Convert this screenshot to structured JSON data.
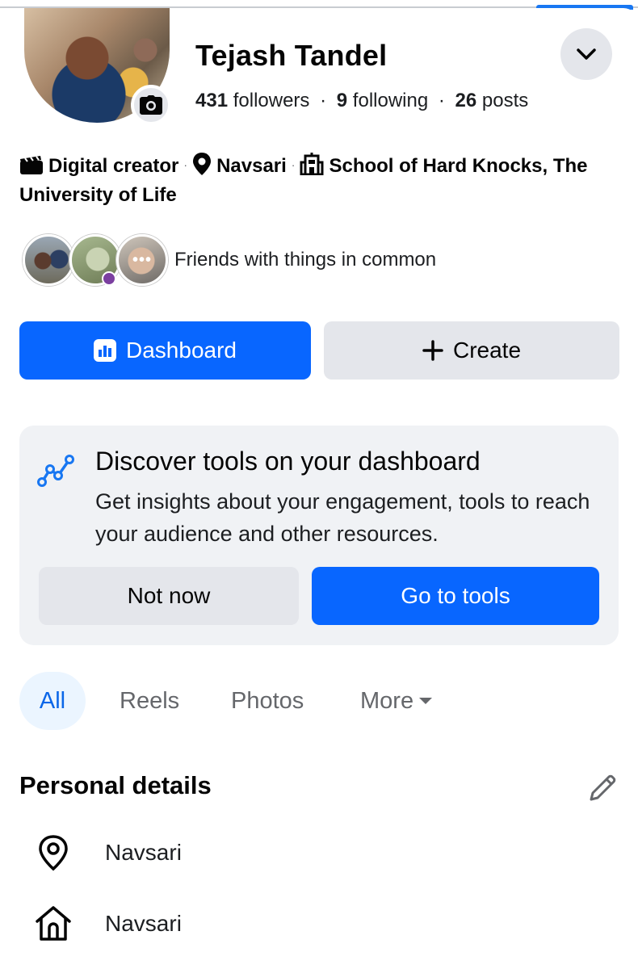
{
  "profile": {
    "name": "Tejash Tandel",
    "followers_count": "431",
    "followers_label": "followers",
    "following_count": "9",
    "following_label": "following",
    "posts_count": "26",
    "posts_label": "posts",
    "separator": "·"
  },
  "intro": {
    "category": "Digital creator",
    "location": "Navsari",
    "education": "School of Hard Knocks, The University of Life",
    "separator": "·"
  },
  "friends": {
    "text": "Friends with things in common",
    "more_dots": "•••"
  },
  "actions": {
    "dashboard_label": "Dashboard",
    "create_label": "Create"
  },
  "discover_card": {
    "title": "Discover tools on your dashboard",
    "description": "Get insights about your engagement, tools to reach your audience and other resources.",
    "not_now_label": "Not now",
    "go_label": "Go to tools"
  },
  "tabs": [
    {
      "label": "All",
      "active": true
    },
    {
      "label": "Reels",
      "active": false
    },
    {
      "label": "Photos",
      "active": false
    },
    {
      "label": "More",
      "active": false
    }
  ],
  "personal_details": {
    "title": "Personal details",
    "items": [
      {
        "icon": "location-pin-icon",
        "value": "Navsari"
      },
      {
        "icon": "home-icon",
        "value": "Navsari"
      }
    ]
  },
  "colors": {
    "accent": "#0866ff",
    "secondary_button": "#e4e6eb",
    "card_bg": "#f0f2f5",
    "active_tab_bg": "#ebf5ff",
    "active_tab_text": "#0a66e8",
    "muted_text": "#65676b"
  }
}
